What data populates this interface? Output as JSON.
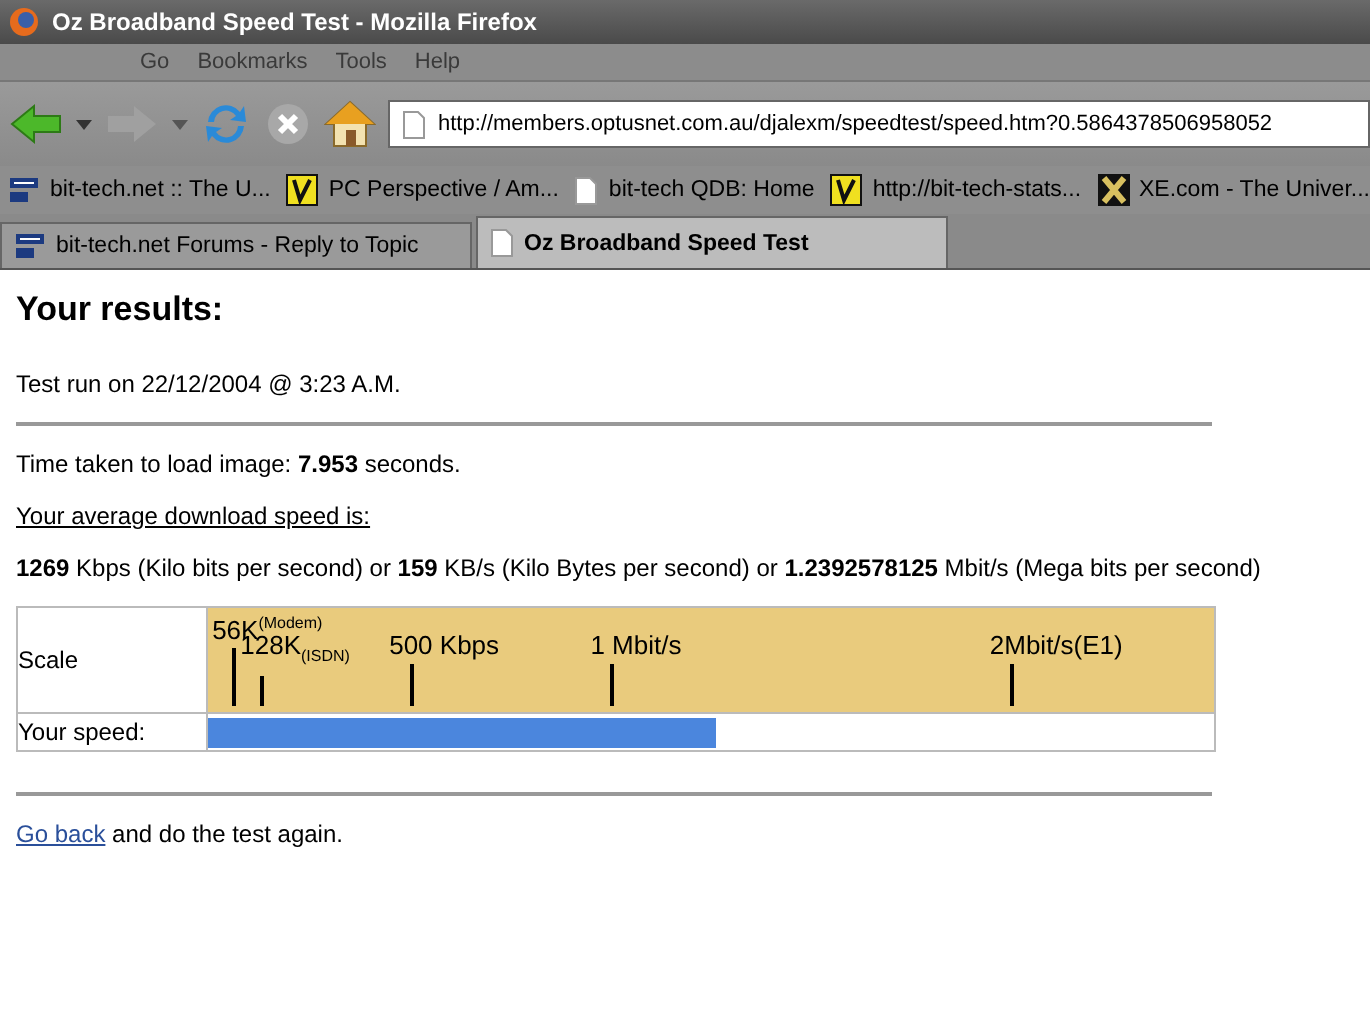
{
  "window": {
    "title": "Oz Broadband Speed Test - Mozilla Firefox"
  },
  "menu": [
    "Go",
    "Bookmarks",
    "Tools",
    "Help"
  ],
  "address": {
    "value": "http://members.optusnet.com.au/djalexm/speedtest/speed.htm?0.5864378506958052"
  },
  "bookmarks": [
    {
      "label": "bit-tech.net :: The U...",
      "kind": "site"
    },
    {
      "label": "PC Perspective / Am...",
      "kind": "pcp"
    },
    {
      "label": "bit-tech QDB: Home",
      "kind": "page"
    },
    {
      "label": "http://bit-tech-stats...",
      "kind": "pcp"
    },
    {
      "label": "XE.com - The Univer...",
      "kind": "xe"
    }
  ],
  "tabs": [
    {
      "label": "bit-tech.net Forums - Reply to Topic",
      "kind": "site",
      "selected": false
    },
    {
      "label": "Oz Broadband Speed Test",
      "kind": "page",
      "selected": true
    }
  ],
  "page": {
    "heading": "Your results:",
    "test_run": "Test run on 22/12/2004 @ 3:23 A.M.",
    "time_taken": "Time taken to load image: **7.953** seconds.",
    "average_label": "Your average download speed is:",
    "speeds": "**1269** Kbps (Kilo bits per second) or **159** KB/s (Kilo Bytes per second) or **1.2392578125** Mbit/s (Mega bits per second)",
    "scale": {
      "label": "Scale",
      "ticks": [
        {
          "label": "56K$^{(Modem)}$",
          "kind": "upper",
          "level": 0.024
        },
        {
          "label": "128K$_{(ISDN)}$",
          "kind": "lower",
          "level": 0.052
        },
        {
          "label": "500 Kbps",
          "kind": "lower",
          "level": 0.2
        },
        {
          "label": "1 Mbit/s",
          "kind": "lower",
          "level": 0.4
        },
        {
          "label": "2Mbit/s(E1)",
          "kind": "lower",
          "level": 0.797
        }
      ]
    },
    "speed": {
      "label": "Your speed:",
      "level": 0.505
    },
    "go_back": "Go back",
    "again": "and do the test again."
  }
}
